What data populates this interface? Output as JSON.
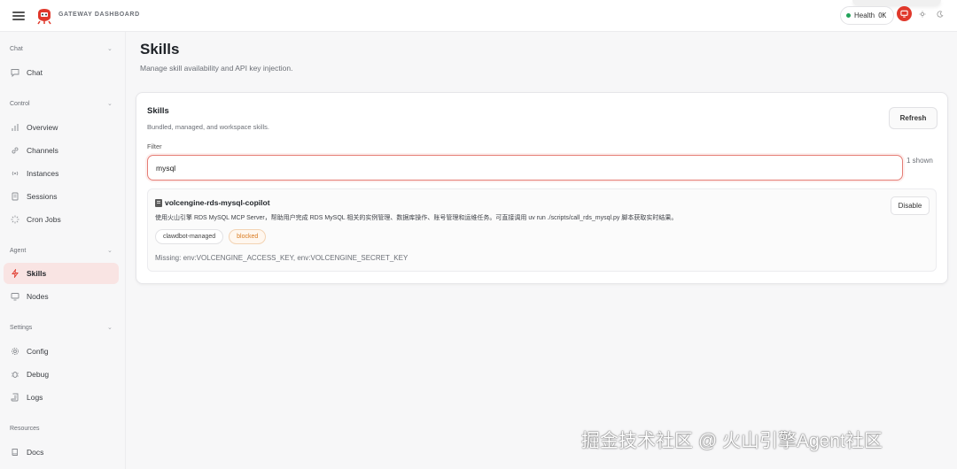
{
  "header": {
    "brand": "GATEWAY DASHBOARD",
    "health_label": "Health",
    "health_status": "OK",
    "accent_color": "#e0382b"
  },
  "sidebar": {
    "sections": [
      {
        "label": "Chat",
        "items": [
          {
            "label": "Chat",
            "icon": "message-icon"
          }
        ]
      },
      {
        "label": "Control",
        "items": [
          {
            "label": "Overview",
            "icon": "bar-chart-icon"
          },
          {
            "label": "Channels",
            "icon": "link-icon"
          },
          {
            "label": "Instances",
            "icon": "radio-icon"
          },
          {
            "label": "Sessions",
            "icon": "document-icon"
          },
          {
            "label": "Cron Jobs",
            "icon": "loader-icon"
          }
        ]
      },
      {
        "label": "Agent",
        "items": [
          {
            "label": "Skills",
            "icon": "zap-icon",
            "active": true
          },
          {
            "label": "Nodes",
            "icon": "monitor-icon"
          }
        ]
      },
      {
        "label": "Settings",
        "items": [
          {
            "label": "Config",
            "icon": "gear-icon"
          },
          {
            "label": "Debug",
            "icon": "bug-icon"
          },
          {
            "label": "Logs",
            "icon": "scroll-icon"
          }
        ]
      },
      {
        "label": "Resources",
        "items": [
          {
            "label": "Docs",
            "icon": "book-icon"
          }
        ]
      }
    ]
  },
  "page": {
    "title": "Skills",
    "subtitle": "Manage skill availability and API key injection."
  },
  "skills_card": {
    "title": "Skills",
    "subtitle": "Bundled, managed, and workspace skills.",
    "refresh_label": "Refresh",
    "filter_label": "Filter",
    "filter_value": "mysql",
    "shown_count": "1 shown",
    "items": [
      {
        "name": "volcengine-rds-mysql-copilot",
        "description": "使用火山引擎 RDS MySQL MCP Server，帮助用户完成 RDS MySQL 相关的实例管理、数据库操作、账号管理和运维任务。可直接调用 uv run ./scripts/call_rds_mysql.py 脚本获取实时结果。",
        "tags": [
          "clawdbot-managed",
          "blocked"
        ],
        "missing": "Missing: env:VOLCENGINE_ACCESS_KEY, env:VOLCENGINE_SECRET_KEY",
        "action_label": "Disable"
      }
    ]
  },
  "watermark": "掘金技术社区 @ 火山引擎Agent社区"
}
